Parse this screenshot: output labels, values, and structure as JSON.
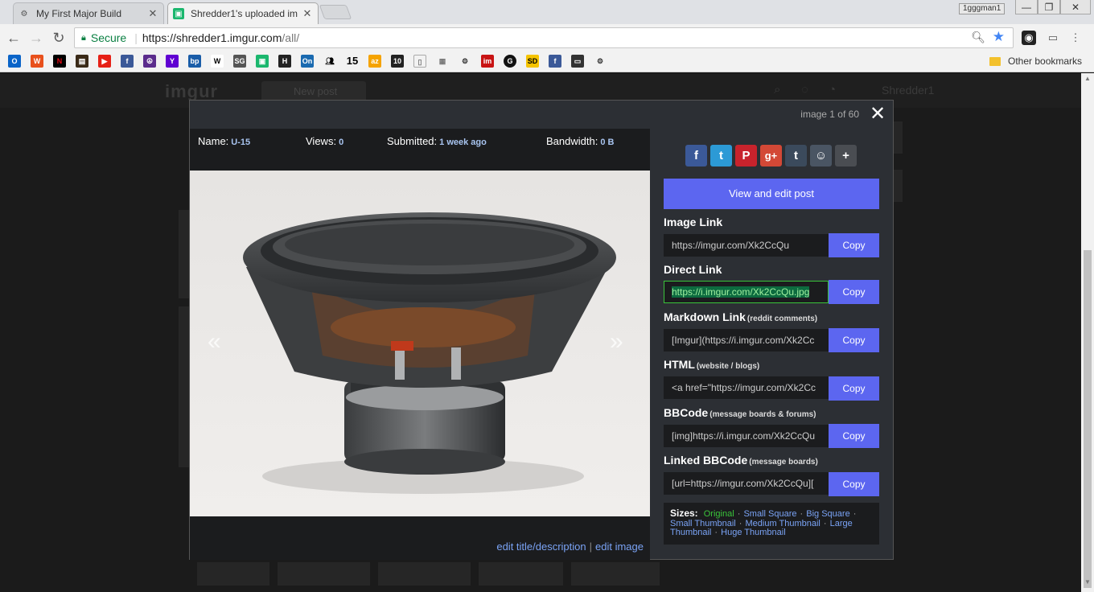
{
  "tabs": [
    {
      "title": "My First Major Build",
      "favicon": "forum-icon",
      "active": false
    },
    {
      "title": "Shredder1's uploaded im",
      "favicon": "imgur-icon",
      "active": true
    }
  ],
  "profile_name": "1gggman1",
  "toolbar": {
    "secure_label": "Secure",
    "url_scheme_host": "https://shredder1.imgur.com",
    "url_path": "/all/"
  },
  "bookmarks": {
    "items": [
      "outlook-icon",
      "wf-icon",
      "netflix-icon",
      "toolbox-icon",
      "youtube-icon",
      "facebook-icon",
      "peace-icon",
      "yahoo-icon",
      "bp-icon",
      "wikipedia-icon",
      "sg-icon",
      "imgur-icon",
      "hs-icon",
      "on-icon",
      "people-icon",
      "fifteen-icon",
      "news-icon",
      "fox10-icon",
      "doc-icon",
      "calc-icon",
      "forum-icon",
      "im-icon",
      "g-icon",
      "sd-icon",
      "facebook-icon",
      "pe-icon",
      "forum-icon"
    ],
    "other_label": "Other bookmarks"
  },
  "imgur_bg": {
    "logo": "imgur",
    "new_post": "New post",
    "user": "Shredder1"
  },
  "modal": {
    "counter": "image 1 of 60",
    "meta": {
      "name_label": "Name:",
      "name_value": "U-15",
      "views_label": "Views:",
      "views_value": "0",
      "submitted_label": "Submitted:",
      "submitted_value": "1 week ago",
      "bandwidth_label": "Bandwidth:",
      "bandwidth_value": "0 B"
    },
    "prev_arrow": "«",
    "next_arrow": "»",
    "footer": {
      "edit_title": "edit title/description",
      "separator": "|",
      "edit_image": "edit image"
    },
    "sidebar": {
      "social": [
        {
          "name": "facebook-share-icon",
          "glyph": "f",
          "color": "#3b5998"
        },
        {
          "name": "twitter-share-icon",
          "glyph": "t",
          "color": "#2c9ad6"
        },
        {
          "name": "pinterest-share-icon",
          "glyph": "P",
          "color": "#c8232c"
        },
        {
          "name": "googleplus-share-icon",
          "glyph": "g+",
          "color": "#d34836"
        },
        {
          "name": "tumblr-share-icon",
          "glyph": "t",
          "color": "#3b4a5c"
        },
        {
          "name": "reddit-share-icon",
          "glyph": "☺",
          "color": "#4a5563"
        },
        {
          "name": "more-share-icon",
          "glyph": "+",
          "color": "#4a4d52"
        }
      ],
      "view_edit_label": "View and edit post",
      "links": [
        {
          "label": "Image Link",
          "sub": "",
          "value": "https://imgur.com/Xk2CcQu",
          "copy": "Copy",
          "highlight": false
        },
        {
          "label": "Direct Link",
          "sub": "",
          "value": "https://i.imgur.com/Xk2CcQu.jpg",
          "copy": "Copy",
          "highlight": true
        },
        {
          "label": "Markdown Link",
          "sub": "(reddit comments)",
          "value": "[Imgur](https://i.imgur.com/Xk2Cc",
          "copy": "Copy",
          "highlight": false
        },
        {
          "label": "HTML",
          "sub": "(website / blogs)",
          "value": "<a href=\"https://imgur.com/Xk2Cc",
          "copy": "Copy",
          "highlight": false
        },
        {
          "label": "BBCode",
          "sub": "(message boards & forums)",
          "value": "[img]https://i.imgur.com/Xk2CcQu",
          "copy": "Copy",
          "highlight": false
        },
        {
          "label": "Linked BBCode",
          "sub": "(message boards)",
          "value": "[url=https://imgur.com/Xk2CcQu][",
          "copy": "Copy",
          "highlight": false
        }
      ],
      "sizes": {
        "title": "Sizes:",
        "original": "Original",
        "options": [
          "Small Square",
          "Big Square",
          "Small Thumbnail",
          "Medium Thumbnail",
          "Large Thumbnail",
          "Huge Thumbnail"
        ]
      }
    }
  },
  "colors": {
    "accent": "#5c66f0",
    "link": "#7aa3f5",
    "highlight_green": "#3ac43a",
    "modal_bg": "#2c2f34",
    "panel_bg": "#1b1c1e"
  }
}
